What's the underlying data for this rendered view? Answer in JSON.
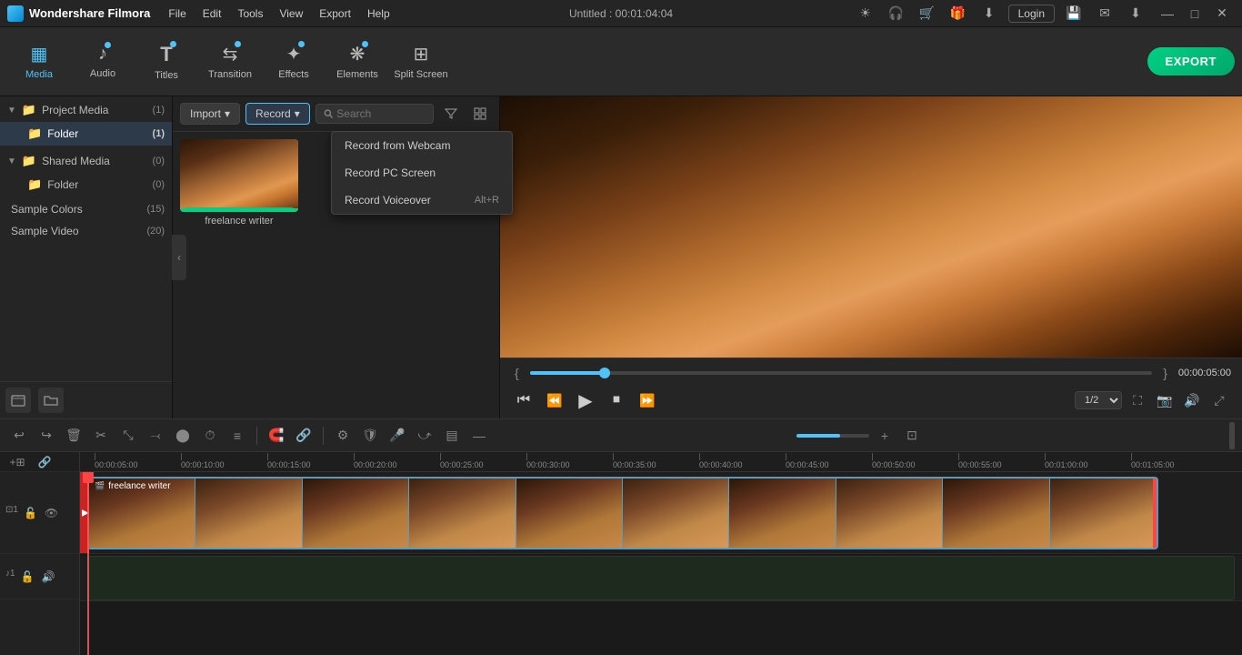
{
  "app": {
    "name": "Wondershare Filmora",
    "logo_text": "Wondershare Filmora",
    "title": "Untitled : 00:01:04:04"
  },
  "menu": {
    "items": [
      "File",
      "Edit",
      "Tools",
      "View",
      "Export",
      "Help"
    ]
  },
  "title_bar": {
    "window_controls": {
      "minimize": "—",
      "maximize": "□",
      "close": "✕"
    },
    "icons": [
      "☀",
      "🎧",
      "🛒",
      "🎁"
    ],
    "login": "Login"
  },
  "toolbar": {
    "items": [
      {
        "id": "media",
        "label": "Media",
        "icon": "▦",
        "active": true,
        "dot": false
      },
      {
        "id": "audio",
        "label": "Audio",
        "icon": "♪",
        "active": false,
        "dot": true
      },
      {
        "id": "titles",
        "label": "Titles",
        "icon": "T",
        "active": false,
        "dot": true
      },
      {
        "id": "transition",
        "label": "Transition",
        "icon": "⇆",
        "active": false,
        "dot": true
      },
      {
        "id": "effects",
        "label": "Effects",
        "icon": "✦",
        "active": false,
        "dot": true
      },
      {
        "id": "elements",
        "label": "Elements",
        "icon": "❋",
        "active": false,
        "dot": true
      },
      {
        "id": "split_screen",
        "label": "Split Screen",
        "icon": "⊞",
        "active": false,
        "dot": false
      }
    ],
    "export_label": "EXPORT"
  },
  "left_panel": {
    "sections": [
      {
        "label": "Project Media",
        "count": "(1)",
        "expanded": true,
        "children": [
          {
            "label": "Folder",
            "count": "(1)",
            "active": true,
            "indent": 1
          }
        ]
      },
      {
        "label": "Shared Media",
        "count": "(0)",
        "expanded": true,
        "children": [
          {
            "label": "Folder",
            "count": "(0)",
            "active": false,
            "indent": 1
          }
        ]
      },
      {
        "label": "Sample Colors",
        "count": "(15)",
        "active": false,
        "indent": 0
      },
      {
        "label": "Sample Video",
        "count": "(20)",
        "active": false,
        "indent": 0
      }
    ],
    "footer_icons": [
      "new_folder",
      "folder"
    ]
  },
  "media_toolbar": {
    "import_label": "Import",
    "record_label": "Record",
    "search_placeholder": "Search",
    "dropdown_open": true,
    "dropdown_items": [
      {
        "label": "Record from Webcam",
        "shortcut": ""
      },
      {
        "label": "Record PC Screen",
        "shortcut": ""
      },
      {
        "label": "Record Voiceover",
        "shortcut": "Alt+R"
      }
    ]
  },
  "media_content": {
    "items": [
      {
        "label": "freelance writer",
        "has_thumb": true
      }
    ]
  },
  "preview": {
    "time_display": "00:00:05:00",
    "quality_label": "1/2",
    "progress_pct": 12
  },
  "playback": {
    "step_back": "⏮",
    "step_fwd": "⏭",
    "play": "▶",
    "stop": "⏹",
    "frame_back": "⏪",
    "bracket_left": "{",
    "bracket_right": "}"
  },
  "timeline": {
    "toolbar_icons": [
      "↩",
      "↪",
      "🗑",
      "✂",
      "⤡",
      "⤙",
      "⬤",
      "⏱",
      "≡"
    ],
    "ruler_marks": [
      "00:00:05:00",
      "00:00:10:00",
      "00:00:15:00",
      "00:00:20:00",
      "00:00:25:00",
      "00:00:30:00",
      "00:00:35:00",
      "00:00:40:00",
      "00:00:45:00",
      "00:00:50:00",
      "00:00:55:00",
      "00:01:00:00",
      "00:01:05:00"
    ],
    "clip_label": "freelance writer",
    "clip_icon": "🎬"
  }
}
